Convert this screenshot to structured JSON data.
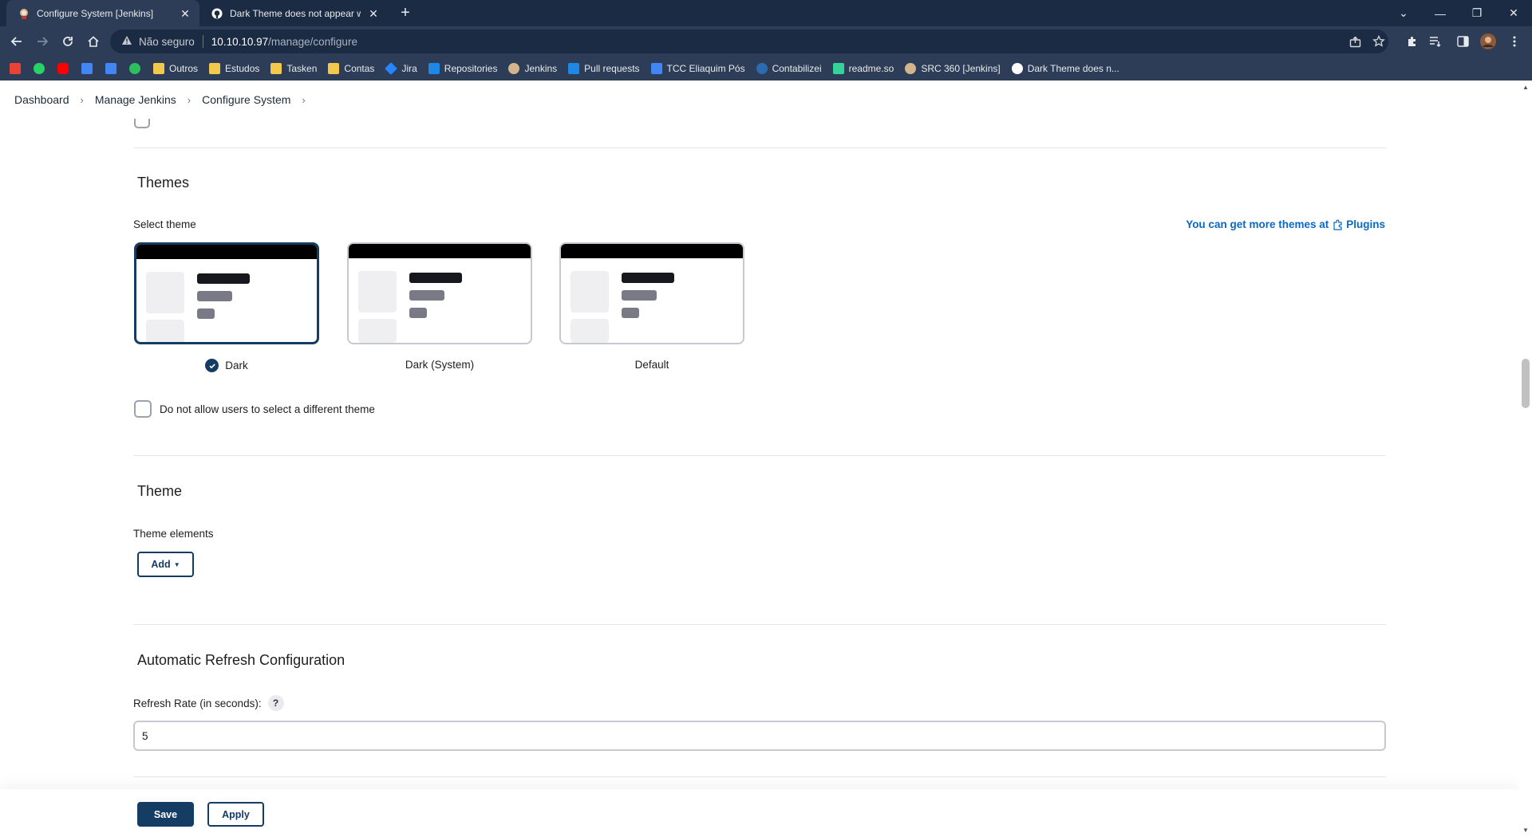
{
  "browser": {
    "tabs": [
      {
        "title": "Configure System [Jenkins]",
        "active": true,
        "favicon": "jenkins-icon"
      },
      {
        "title": "Dark Theme does not appear well",
        "active": false,
        "favicon": "github-icon"
      }
    ],
    "address": {
      "security_text": "Não seguro",
      "host": "10.10.10.97",
      "path": "/manage/configure"
    },
    "bookmarks": [
      {
        "label": "",
        "icon": "gmail-icon",
        "color": "#ea4335"
      },
      {
        "label": "",
        "icon": "whatsapp-icon",
        "color": "#25d366"
      },
      {
        "label": "",
        "icon": "youtube-icon",
        "color": "#ff0000"
      },
      {
        "label": "",
        "icon": "calendar-icon",
        "color": "#4285f4"
      },
      {
        "label": "",
        "icon": "translate-icon",
        "color": "#4285f4"
      },
      {
        "label": "",
        "icon": "evernote-icon",
        "color": "#2dbe60"
      },
      {
        "label": "Outros",
        "icon": "folder-icon",
        "color": "#f2c94c"
      },
      {
        "label": "Estudos",
        "icon": "folder-icon",
        "color": "#f2c94c"
      },
      {
        "label": "Tasken",
        "icon": "folder-icon",
        "color": "#f2c94c"
      },
      {
        "label": "Contas",
        "icon": "folder-icon",
        "color": "#f2c94c"
      },
      {
        "label": "Jira",
        "icon": "jira-icon",
        "color": "#2684ff"
      },
      {
        "label": "Repositories",
        "icon": "azure-repos-icon",
        "color": "#1e88e5"
      },
      {
        "label": "Jenkins",
        "icon": "jenkins-icon",
        "color": "#d4b48c"
      },
      {
        "label": "Pull requests",
        "icon": "azure-repos-icon",
        "color": "#1e88e5"
      },
      {
        "label": "TCC Eliaquim Pós",
        "icon": "docs-icon",
        "color": "#4285f4"
      },
      {
        "label": "Contabilizei",
        "icon": "contabilizei-icon",
        "color": "#2b6cb0"
      },
      {
        "label": "readme.so",
        "icon": "readme-icon",
        "color": "#34d399"
      },
      {
        "label": "SRC 360 [Jenkins]",
        "icon": "jenkins-icon",
        "color": "#d4b48c"
      },
      {
        "label": "Dark Theme does n...",
        "icon": "github-icon",
        "color": "#ffffff"
      }
    ]
  },
  "breadcrumbs": [
    "Dashboard",
    "Manage Jenkins",
    "Configure System"
  ],
  "themes": {
    "heading": "Themes",
    "select_label": "Select theme",
    "more_link_prefix": "You can get more themes at",
    "more_link_target": "Plugins",
    "options": [
      {
        "label": "Dark",
        "selected": true
      },
      {
        "label": "Dark (System)",
        "selected": false
      },
      {
        "label": "Default",
        "selected": false
      }
    ],
    "disallow_label": "Do not allow users to select a different theme"
  },
  "theme": {
    "heading": "Theme",
    "elements_label": "Theme elements",
    "add_button": "Add"
  },
  "refresh": {
    "heading": "Automatic Refresh Configuration",
    "rate_label": "Refresh Rate (in seconds):",
    "help": "?",
    "rate_value": "5"
  },
  "actions": {
    "save": "Save",
    "apply": "Apply"
  },
  "colors": {
    "jenkins_primary": "#153d63",
    "link": "#0b68c2",
    "browser_frame": "#1c2b44"
  }
}
